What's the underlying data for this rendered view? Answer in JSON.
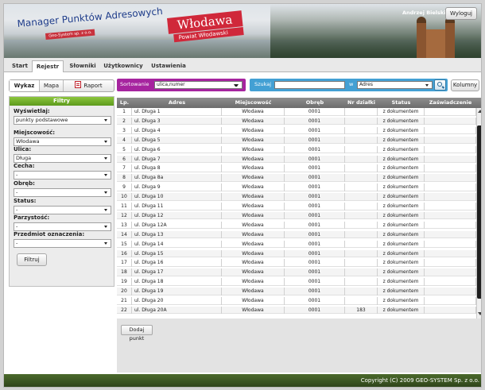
{
  "header": {
    "app_title": "Manager Punktów Adresowych",
    "app_subtitle": "Geo-System sp. z o.o.",
    "city_name": "Włodawa",
    "city_subtitle": "Powiat Włodawski",
    "user_name": "Andrzej Bielski",
    "logout_label": "Wyloguj"
  },
  "tabs": [
    "Start",
    "Rejestr",
    "Słowniki",
    "Użytkownicy",
    "Ustawienia"
  ],
  "active_tab": "Rejestr",
  "toolbar": {
    "wykaz_label": "Wykaz",
    "mapa_label": "Mapa",
    "raport_label": "Raport",
    "sort_label": "Sortowanie",
    "sort_value": "ulica,numer",
    "search_label": "Szukaj",
    "search_value": "",
    "w_label": "w",
    "search_field_value": "Adres",
    "kolumny_label": "Kolumny"
  },
  "filters": {
    "title": "Filtry",
    "wyswietlaj_label": "Wyświetlaj:",
    "wyswietlaj_value": "punkty podstawowe",
    "miejscowosc_label": "Miejscowość:",
    "miejscowosc_value": "Włodawa",
    "ulica_label": "Ulica:",
    "ulica_value": "Długa",
    "cecha_label": "Cecha:",
    "cecha_value": "-",
    "obreb_label": "Obręb:",
    "obreb_value": "-",
    "status_label": "Status:",
    "status_value": "-",
    "parzystosc_label": "Parzystość:",
    "parzystosc_value": "-",
    "przedmiot_label": "Przedmiot oznaczenia:",
    "przedmiot_value": "-",
    "filtruj_label": "Filtruj"
  },
  "table": {
    "columns": [
      "Lp.",
      "Adres",
      "Miejscowość",
      "Obręb",
      "Nr działki",
      "Status",
      "Zaświadczenie"
    ],
    "rows": [
      [
        "1",
        "ul. Długa 1",
        "Włodawa",
        "0001",
        "",
        "z dokumentem",
        ""
      ],
      [
        "2",
        "ul. Długa 3",
        "Włodawa",
        "0001",
        "",
        "z dokumentem",
        ""
      ],
      [
        "3",
        "ul. Długa 4",
        "Włodawa",
        "0001",
        "",
        "z dokumentem",
        ""
      ],
      [
        "4",
        "ul. Długa 5",
        "Włodawa",
        "0001",
        "",
        "z dokumentem",
        ""
      ],
      [
        "5",
        "ul. Długa 6",
        "Włodawa",
        "0001",
        "",
        "z dokumentem",
        ""
      ],
      [
        "6",
        "ul. Długa 7",
        "Włodawa",
        "0001",
        "",
        "z dokumentem",
        ""
      ],
      [
        "7",
        "ul. Długa 8",
        "Włodawa",
        "0001",
        "",
        "z dokumentem",
        ""
      ],
      [
        "8",
        "ul. Długa 8a",
        "Włodawa",
        "0001",
        "",
        "z dokumentem",
        ""
      ],
      [
        "9",
        "ul. Długa 9",
        "Włodawa",
        "0001",
        "",
        "z dokumentem",
        ""
      ],
      [
        "10",
        "ul. Długa 10",
        "Włodawa",
        "0001",
        "",
        "z dokumentem",
        ""
      ],
      [
        "11",
        "ul. Długa 11",
        "Włodawa",
        "0001",
        "",
        "z dokumentem",
        ""
      ],
      [
        "12",
        "ul. Długa 12",
        "Włodawa",
        "0001",
        "",
        "z dokumentem",
        ""
      ],
      [
        "13",
        "ul. Długa 12A",
        "Włodawa",
        "0001",
        "",
        "z dokumentem",
        ""
      ],
      [
        "14",
        "ul. Długa 13",
        "Włodawa",
        "0001",
        "",
        "z dokumentem",
        ""
      ],
      [
        "15",
        "ul. Długa 14",
        "Włodawa",
        "0001",
        "",
        "z dokumentem",
        ""
      ],
      [
        "16",
        "ul. Długa 15",
        "Włodawa",
        "0001",
        "",
        "z dokumentem",
        ""
      ],
      [
        "17",
        "ul. Długa 16",
        "Włodawa",
        "0001",
        "",
        "z dokumentem",
        ""
      ],
      [
        "18",
        "ul. Długa 17",
        "Włodawa",
        "0001",
        "",
        "z dokumentem",
        ""
      ],
      [
        "19",
        "ul. Długa 18",
        "Włodawa",
        "0001",
        "",
        "z dokumentem",
        ""
      ],
      [
        "20",
        "ul. Długa 19",
        "Włodawa",
        "0001",
        "",
        "z dokumentem",
        ""
      ],
      [
        "21",
        "ul. Długa 20",
        "Włodawa",
        "0001",
        "",
        "z dokumentem",
        ""
      ],
      [
        "22",
        "ul. Długa 20A",
        "Włodawa",
        "0001",
        "183",
        "z dokumentem",
        ""
      ]
    ],
    "add_button_label": "Dodaj punkt"
  },
  "footer": {
    "copyright": "Copyright (C) 2009 GEO-SYSTEM Sp. z o.o."
  },
  "icons": {
    "raport": "pdf-icon",
    "search": "search-icon",
    "dropdown": "chevron-down-icon"
  },
  "colors": {
    "sort_bar": "#a6249f",
    "search_bar": "#43a0d4",
    "filters_header": "#6fae26",
    "city_badge": "#d0283a"
  }
}
